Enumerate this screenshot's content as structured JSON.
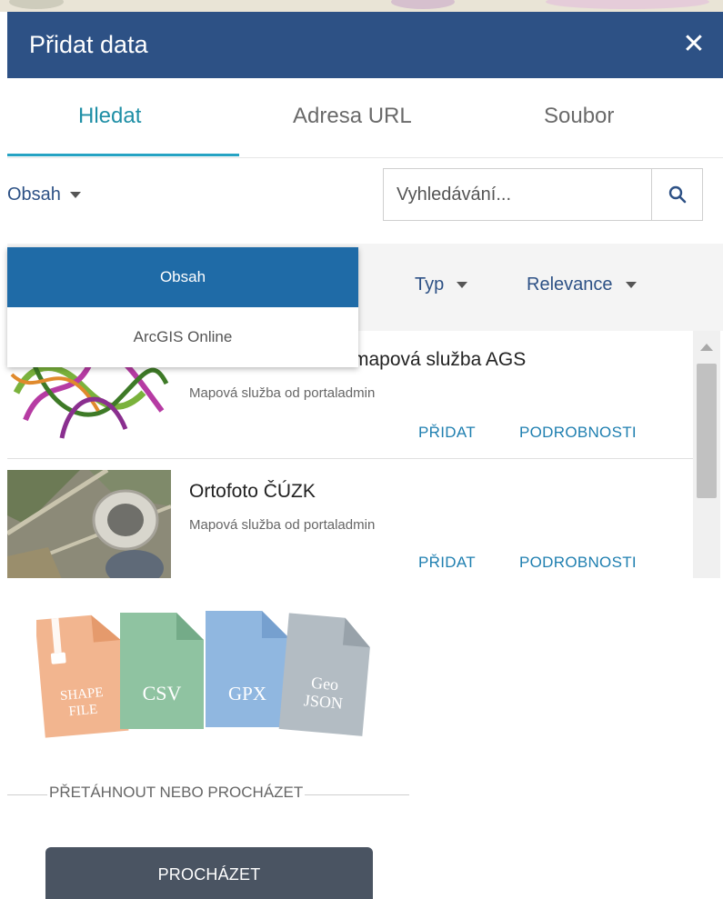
{
  "panel": {
    "title": "Přidat data",
    "close_symbol": "✕"
  },
  "tabs": [
    {
      "label": "Hledat",
      "active": true
    },
    {
      "label": "Adresa URL",
      "active": false
    },
    {
      "label": "Soubor",
      "active": false
    }
  ],
  "filter": {
    "label": "Obsah",
    "icon": "caret-down-icon"
  },
  "search": {
    "placeholder": "Vyhledávání...",
    "icon": "search-icon"
  },
  "sort": {
    "type_label": "Typ",
    "relevance_label": "Relevance"
  },
  "dropdown": {
    "items": [
      {
        "label": "Obsah",
        "selected": true
      },
      {
        "label": "ArcGIS Online",
        "selected": false
      }
    ]
  },
  "results": [
    {
      "title": "mapová služba AGS",
      "subtitle": "Mapová služba od portaladmin",
      "add_label": "PŘIDAT",
      "details_label": "PODROBNOSTI"
    },
    {
      "title": "Ortofoto ČÚZK",
      "subtitle": "Mapová služba od portaladmin",
      "add_label": "PŘIDAT",
      "details_label": "PODROBNOSTI"
    }
  ],
  "file_types": [
    {
      "line1": "SHAPE",
      "line2": "FILE",
      "color": "#f2b58f",
      "zip": true
    },
    {
      "line1": "CSV",
      "line2": "",
      "color": "#8fc3a1"
    },
    {
      "line1": "GPX",
      "line2": "",
      "color": "#90b7e0"
    },
    {
      "line1": "Geo",
      "line2": "JSON",
      "color": "#b3bcc3"
    }
  ],
  "drop": {
    "label": "PŘETÁHNOUT NEBO PROCHÁZET"
  },
  "browse": {
    "label": "PROCHÁZET"
  },
  "colors": {
    "header": "#2d5185",
    "accent": "#26a3c3",
    "link": "#1f7fb0",
    "dropdown_selected": "#1f6ba7",
    "browse_button": "#4a5462"
  }
}
